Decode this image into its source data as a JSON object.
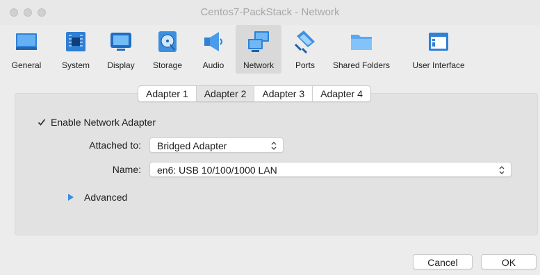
{
  "window": {
    "title": "Centos7-PackStack - Network"
  },
  "toolbar": {
    "items": [
      {
        "label": "General",
        "icon": "monitor-general-icon"
      },
      {
        "label": "System",
        "icon": "chip-icon"
      },
      {
        "label": "Display",
        "icon": "display-icon"
      },
      {
        "label": "Storage",
        "icon": "disk-icon"
      },
      {
        "label": "Audio",
        "icon": "speaker-icon"
      },
      {
        "label": "Network",
        "icon": "network-icon",
        "active": true
      },
      {
        "label": "Ports",
        "icon": "serial-port-icon"
      },
      {
        "label": "Shared Folders",
        "icon": "folder-icon"
      },
      {
        "label": "User Interface",
        "icon": "window-icon"
      }
    ]
  },
  "tabs": [
    {
      "label": "Adapter 1"
    },
    {
      "label": "Adapter 2",
      "selected": true
    },
    {
      "label": "Adapter 3"
    },
    {
      "label": "Adapter 4"
    }
  ],
  "adapter": {
    "enable_label": "Enable Network Adapter",
    "enabled": true,
    "attached_label": "Attached to:",
    "attached_value": "Bridged Adapter",
    "name_label": "Name:",
    "name_value": "en6: USB 10/100/1000 LAN",
    "advanced_label": "Advanced"
  },
  "buttons": {
    "cancel": "Cancel",
    "ok": "OK"
  },
  "colors": {
    "accent": "#3b8ae6",
    "window_bg": "#ececec",
    "panel_bg": "#e2e2e2"
  }
}
